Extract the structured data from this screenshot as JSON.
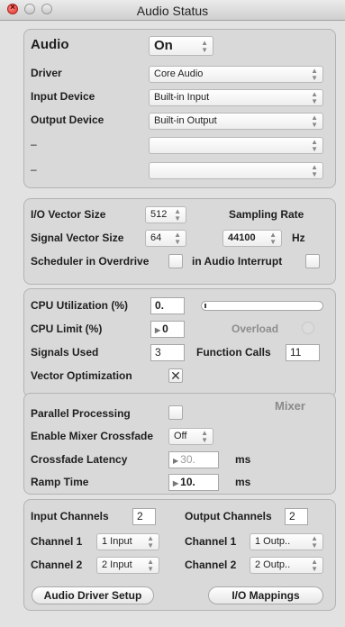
{
  "window": {
    "title": "Audio Status"
  },
  "audio_panel": {
    "audio_label": "Audio",
    "audio_value": "On",
    "driver_label": "Driver",
    "driver_value": "Core Audio",
    "input_device_label": "Input Device",
    "input_device_value": "Built-in Input",
    "output_device_label": "Output Device",
    "output_device_value": "Built-in Output",
    "extra1_label": "–",
    "extra1_value": "",
    "extra2_label": "–",
    "extra2_value": ""
  },
  "vector_panel": {
    "io_vector_label": "I/O Vector Size",
    "io_vector_value": "512",
    "sampling_rate_label": "Sampling Rate",
    "signal_vector_label": "Signal Vector Size",
    "signal_vector_value": "64",
    "sampling_rate_value": "44100",
    "hz_label": "Hz",
    "scheduler_label": "Scheduler in Overdrive",
    "scheduler_checked": false,
    "interrupt_label": "in Audio Interrupt",
    "interrupt_checked": false
  },
  "cpu_panel": {
    "cpu_util_label": "CPU Utilization (%)",
    "cpu_util_value": "0.",
    "cpu_util_fraction": 0.01,
    "cpu_limit_label": "CPU Limit (%)",
    "cpu_limit_value": "0",
    "overload_label": "Overload",
    "signals_label": "Signals Used",
    "signals_value": "3",
    "function_calls_label": "Function Calls",
    "function_calls_value": "11",
    "vector_opt_label": "Vector Optimization",
    "vector_opt_checked": true,
    "vector_opt_mark": "✕"
  },
  "mixer_panel": {
    "mixer_heading": "Mixer",
    "parallel_label": "Parallel Processing",
    "parallel_checked": false,
    "crossfade_enable_label": "Enable Mixer Crossfade",
    "crossfade_enable_value": "Off",
    "crossfade_latency_label": "Crossfade Latency",
    "crossfade_latency_value": "30.",
    "ms1": "ms",
    "ramp_time_label": "Ramp Time",
    "ramp_time_value": "10.",
    "ms2": "ms"
  },
  "channels_panel": {
    "input_channels_label": "Input Channels",
    "input_channels_value": "2",
    "output_channels_label": "Output Channels",
    "output_channels_value": "2",
    "in_ch1_label": "Channel 1",
    "in_ch1_value": "1 Input",
    "in_ch2_label": "Channel 2",
    "in_ch2_value": "2 Input",
    "out_ch1_label": "Channel 1",
    "out_ch1_value": "1 Outp..",
    "out_ch2_label": "Channel 2",
    "out_ch2_value": "2 Outp..",
    "driver_setup_button": "Audio Driver Setup",
    "io_mappings_button": "I/O Mappings"
  }
}
